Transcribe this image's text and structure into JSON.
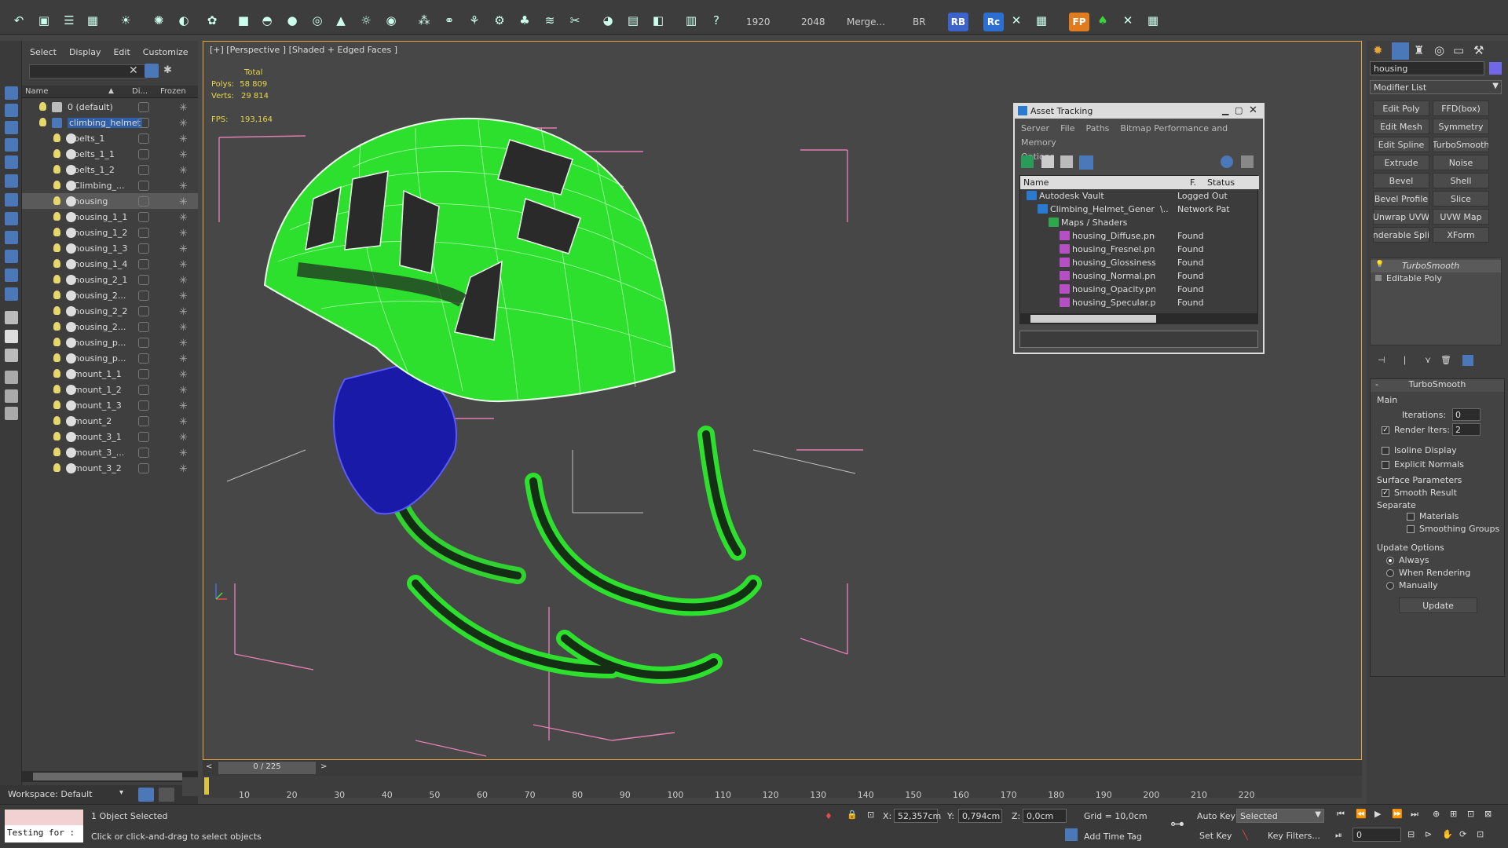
{
  "toolbar": {
    "render_width": "1920",
    "render_height": "2048",
    "merge_label": "Merge...",
    "br_label": "BR",
    "rb_badge": "RB",
    "rc_badge": "Rc",
    "fp_badge": "FP"
  },
  "scene_explorer": {
    "menu": [
      "Select",
      "Display",
      "Edit",
      "Customize"
    ],
    "columns": {
      "name": "Name",
      "display": "Di...",
      "frozen": "Frozen"
    },
    "items": [
      {
        "label": "0 (default)",
        "level": 0,
        "selected": false
      },
      {
        "label": "climbing_helmet",
        "level": 0,
        "selected": false
      },
      {
        "label": "belts_1",
        "level": 1,
        "selected": false
      },
      {
        "label": "belts_1_1",
        "level": 1,
        "selected": false
      },
      {
        "label": "belts_1_2",
        "level": 1,
        "selected": false
      },
      {
        "label": "Climbing_...",
        "level": 1,
        "selected": false
      },
      {
        "label": "housing",
        "level": 1,
        "selected": true
      },
      {
        "label": "housing_1_1",
        "level": 1,
        "selected": false
      },
      {
        "label": "housing_1_2",
        "level": 1,
        "selected": false
      },
      {
        "label": "housing_1_3",
        "level": 1,
        "selected": false
      },
      {
        "label": "housing_1_4",
        "level": 1,
        "selected": false
      },
      {
        "label": "housing_2_1",
        "level": 1,
        "selected": false
      },
      {
        "label": "housing_2...",
        "level": 1,
        "selected": false
      },
      {
        "label": "housing_2_2",
        "level": 1,
        "selected": false
      },
      {
        "label": "housing_2...",
        "level": 1,
        "selected": false
      },
      {
        "label": "housing_p...",
        "level": 1,
        "selected": false
      },
      {
        "label": "housing_p...",
        "level": 1,
        "selected": false
      },
      {
        "label": "mount_1_1",
        "level": 1,
        "selected": false
      },
      {
        "label": "mount_1_2",
        "level": 1,
        "selected": false
      },
      {
        "label": "mount_1_3",
        "level": 1,
        "selected": false
      },
      {
        "label": "mount_2",
        "level": 1,
        "selected": false
      },
      {
        "label": "mount_3_1",
        "level": 1,
        "selected": false
      },
      {
        "label": "mount_3_...",
        "level": 1,
        "selected": false
      },
      {
        "label": "mount_3_2",
        "level": 1,
        "selected": false
      }
    ],
    "workspace": "Workspace: Default"
  },
  "viewport": {
    "label": "[+] [Perspective ] [Shaded + Edged Faces ]",
    "stats": {
      "total_label": "Total",
      "polys_label": "Polys:",
      "polys_value": "58 809",
      "verts_label": "Verts:",
      "verts_value": "29 814",
      "fps_label": "FPS:",
      "fps_value": "193,164"
    },
    "colors": {
      "helmet": "#2ee02e",
      "harness": "#1a1aa8",
      "frame": "#e6a63b"
    }
  },
  "asset_tracking": {
    "title": "Asset Tracking",
    "menu_row1": [
      "Server",
      "File",
      "Paths",
      "Bitmap Performance and Memory"
    ],
    "menu_row2": [
      "Options"
    ],
    "columns": {
      "name": "Name",
      "f": "F.",
      "status": "Status"
    },
    "rows": [
      {
        "name": "Autodesk Vault",
        "f": "",
        "status": "Logged Out",
        "indent": 1,
        "png": false
      },
      {
        "name": "Climbing_Helmet_Generic_vra...",
        "f": "\\..",
        "status": "Network Pat",
        "indent": 2,
        "png": false
      },
      {
        "name": "Maps / Shaders",
        "f": "",
        "status": "",
        "indent": 3,
        "png": false
      },
      {
        "name": "housing_Diffuse.png",
        "f": "",
        "status": "Found",
        "indent": 4,
        "png": true
      },
      {
        "name": "housing_Fresnel.png",
        "f": "",
        "status": "Found",
        "indent": 4,
        "png": true
      },
      {
        "name": "housing_Glossiness.png",
        "f": "",
        "status": "Found",
        "indent": 4,
        "png": true
      },
      {
        "name": "housing_Normal.png",
        "f": "",
        "status": "Found",
        "indent": 4,
        "png": true
      },
      {
        "name": "housing_Opacity.png",
        "f": "",
        "status": "Found",
        "indent": 4,
        "png": true
      },
      {
        "name": "housing_Specular.png",
        "f": "",
        "status": "Found",
        "indent": 4,
        "png": true
      }
    ]
  },
  "command_panel": {
    "object_name": "housing",
    "modifier_list": "Modifier List",
    "buttons": [
      "Edit Poly",
      "FFD(box)",
      "Edit Mesh",
      "Symmetry",
      "Edit Spline",
      "TurboSmooth",
      "Extrude",
      "Noise",
      "Bevel",
      "Shell",
      "Bevel Profile",
      "Slice",
      "Unwrap UVW",
      "UVW Map",
      "enderable Splin",
      "XForm"
    ],
    "stack": [
      "TurboSmooth",
      "Editable Poly"
    ],
    "rollout_title": "TurboSmooth",
    "main_label": "Main",
    "iterations_label": "Iterations:",
    "iterations_value": "0",
    "render_iters_label": "Render Iters:",
    "render_iters_value": "2",
    "isoline_label": "Isoline Display",
    "explicit_normals_label": "Explicit Normals",
    "surface_params_label": "Surface Parameters",
    "smooth_result_label": "Smooth Result",
    "separate_label": "Separate",
    "materials_label": "Materials",
    "smoothing_groups_label": "Smoothing Groups",
    "update_options_label": "Update Options",
    "always_label": "Always",
    "when_rendering_label": "When Rendering",
    "manually_label": "Manually",
    "update_button": "Update"
  },
  "timeline": {
    "frame_counter": "0 / 225",
    "ticks": [
      "10",
      "20",
      "30",
      "40",
      "50",
      "60",
      "70",
      "80",
      "90",
      "100",
      "110",
      "120",
      "130",
      "140",
      "150",
      "160",
      "170",
      "180",
      "190",
      "200",
      "210",
      "220"
    ]
  },
  "status_bar": {
    "testing_label": "Testing for :",
    "selection_status": "1 Object Selected",
    "prompt": "Click or click-and-drag to select objects",
    "x_label": "X:",
    "x_value": "52,357cm",
    "y_label": "Y:",
    "y_value": "0,794cm",
    "z_label": "Z:",
    "z_value": "0,0cm",
    "grid": "Grid = 10,0cm",
    "add_time_tag": "Add Time Tag",
    "auto_key": "Auto Key",
    "set_key": "Set Key",
    "selected_dropdown": "Selected",
    "key_filters": "Key Filters...",
    "frame_value": "0"
  }
}
